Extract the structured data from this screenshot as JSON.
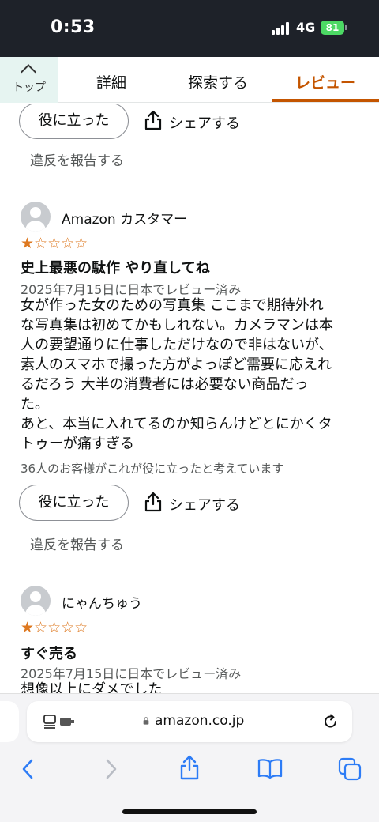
{
  "status_bar": {
    "time": "0:53",
    "network": "4G",
    "battery": "81"
  },
  "tab_bar": {
    "top_label": "トップ",
    "tabs": [
      "詳細",
      "探索する",
      "レビュー"
    ],
    "active_tab": "レビュー",
    "accent_color": "#c45500"
  },
  "top_actions": {
    "helpful": "役に立った",
    "share": "シェアする",
    "report": "違反を報告する"
  },
  "reviews": [
    {
      "reviewer": "Amazon カスタマー",
      "rating": 1,
      "stars_display": {
        "filled": "★",
        "empty": "☆☆☆☆"
      },
      "title": "史上最悪の駄作 やり直してね",
      "date": "2025年7月15日に日本でレビュー済み",
      "body_lines": [
        "女が作った女のための写真集 ここまで期待外れ",
        "な写真集は初めてかもしれない。カメラマンは本",
        "人の要望通りに仕事しただけなので非はないが、",
        "素人のスマホで撮った方がよっぽど需要に応えれ",
        "るだろう 大半の消費者には必要ない商品だっ",
        "た。",
        "あと、本当に入れてるのか知らんけどとにかくタ",
        "トゥーが痛すぎる"
      ],
      "helpful_count": "36人のお客様がこれが役に立ったと考えています",
      "helpful_button": "役に立った",
      "share": "シェアする",
      "report": "違反を報告する"
    },
    {
      "reviewer": "にゃんちゅう",
      "rating": 1,
      "stars_display": {
        "filled": "★",
        "empty": "☆☆☆☆"
      },
      "title": "すぐ売る",
      "date": "2025年7月15日に日本でレビュー済み",
      "body_lines": [
        "想像以上にダメでした"
      ]
    }
  ],
  "browser": {
    "url": "amazon.co.jp"
  },
  "colors": {
    "status_bar_bg": "#1e2229",
    "star": "#de7921",
    "safari_blue": "#2d7cf6"
  }
}
